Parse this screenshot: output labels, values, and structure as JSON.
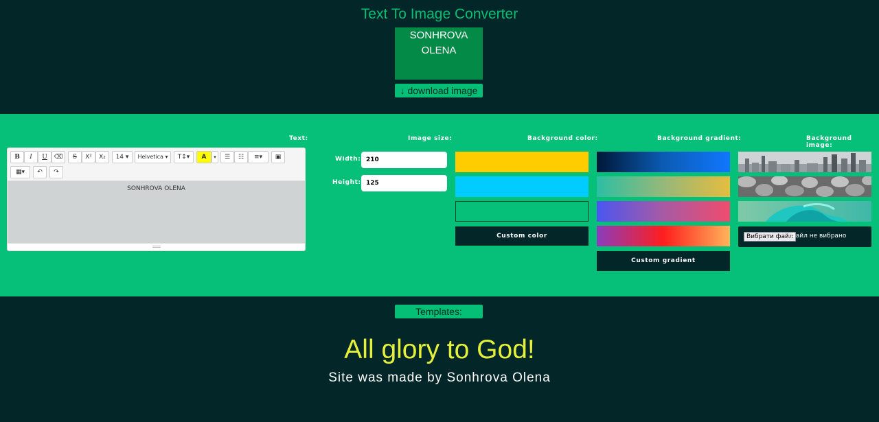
{
  "header": {
    "title": "Text To Image Converter",
    "preview_text": "SONHROVA OLENA",
    "download_label": "↓ download image"
  },
  "panel": {
    "text_label": "Text:",
    "size_label": "Image size:",
    "bgcolor_label": "Background color:",
    "gradient_label": "Background gradient:",
    "bgimage_label": "Background image:"
  },
  "editor": {
    "content": "SONHROVA OLENA",
    "font_size": "14",
    "font_family": "Helvetica",
    "toolbar": {
      "bold": "B",
      "italic": "I",
      "underline": "U",
      "eraser": "⌫",
      "strike": "S",
      "superscript": "X²",
      "subscript": "X₂",
      "font_size": "14 ▾",
      "font_family": "Helvetica ▾",
      "text_height": "T↕▾",
      "text_color": "A",
      "text_color_caret": "▾",
      "bullet_list": "☰",
      "numbered_list": "☷",
      "align": "≡▾",
      "picture": "▣",
      "table": "▦▾",
      "undo": "↶",
      "redo": "↷"
    }
  },
  "image_size": {
    "width_label": "Width:",
    "width_value": "210",
    "height_label": "Height:",
    "height_value": "125"
  },
  "background_colors": {
    "swatches": [
      "#ffcc00",
      "#00ccff",
      "#06bf78"
    ],
    "custom_label": "Custom color"
  },
  "background_gradients": {
    "swatches": [
      "linear-gradient(to right, #001737, #0b5bb4 50%, #1177ff)",
      "linear-gradient(to right, #2bbfa2, #96b87a 50%, #e6bc3e)",
      "linear-gradient(to right, #4a56f2, #a85aa3 50%, #f04c6e)",
      "linear-gradient(to right, #8a3cbd, #ff1e1e 50%, #ffb45a)"
    ],
    "custom_label": "Custom gradient"
  },
  "background_images": {
    "swatches": [
      "city-skyline-image",
      "pebbles-image",
      "abstract-wave-image"
    ],
    "file_button": "Вибрати файл",
    "file_status": "Файл не вибрано"
  },
  "footer": {
    "templates_label": "Templates:",
    "glory_text": "All glory to God!",
    "credit_text": "Site was made by Sonhrova Olena"
  }
}
